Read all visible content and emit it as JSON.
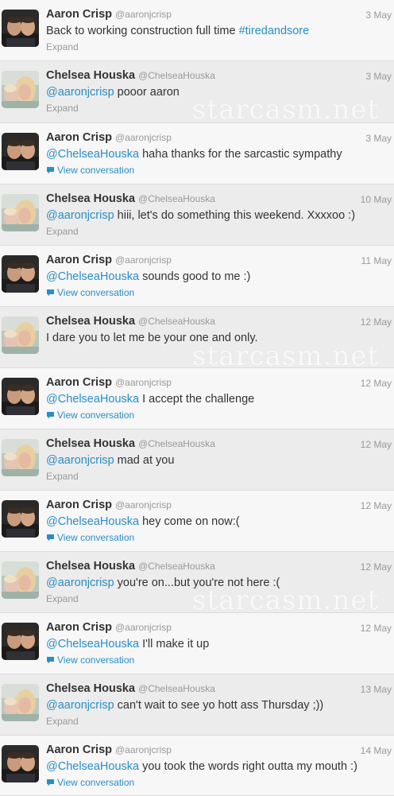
{
  "watermark": "starcasm.net",
  "tweets": [
    {
      "author": "Aaron Crisp",
      "handle": "@aaronjcrisp",
      "date": "3 May",
      "mention": "",
      "text": "Back to working construction full time ",
      "hashtag": "#tiredandsore",
      "action": "Expand",
      "avatar": "aaron"
    },
    {
      "author": "Chelsea Houska",
      "handle": "@ChelseaHouska",
      "date": "3 May",
      "mention": "@aaronjcrisp",
      "text": " pooor aaron",
      "hashtag": "",
      "action": "Expand",
      "avatar": "chelsea"
    },
    {
      "author": "Aaron Crisp",
      "handle": "@aaronjcrisp",
      "date": "3 May",
      "mention": "@ChelseaHouska",
      "text": " haha thanks for the sarcastic sympathy",
      "hashtag": "",
      "action": "View conversation",
      "avatar": "aaron"
    },
    {
      "author": "Chelsea Houska",
      "handle": "@ChelseaHouska",
      "date": "10 May",
      "mention": "@aaronjcrisp",
      "text": " hiii, let's do something this weekend. Xxxxoo :)",
      "hashtag": "",
      "action": "Expand",
      "avatar": "chelsea"
    },
    {
      "author": "Aaron Crisp",
      "handle": "@aaronjcrisp",
      "date": "11 May",
      "mention": "@ChelseaHouska",
      "text": " sounds good to me :)",
      "hashtag": "",
      "action": "View conversation",
      "avatar": "aaron"
    },
    {
      "author": "Chelsea Houska",
      "handle": "@ChelseaHouska",
      "date": "12 May",
      "mention": "",
      "text": "I dare you to let me be your one and only.",
      "hashtag": "",
      "action": "",
      "avatar": "chelsea"
    },
    {
      "author": "Aaron Crisp",
      "handle": "@aaronjcrisp",
      "date": "12 May",
      "mention": "@ChelseaHouska",
      "text": " I accept the challenge",
      "hashtag": "",
      "action": "View conversation",
      "avatar": "aaron"
    },
    {
      "author": "Chelsea Houska",
      "handle": "@ChelseaHouska",
      "date": "12 May",
      "mention": "@aaronjcrisp",
      "text": " mad at you",
      "hashtag": "",
      "action": "Expand",
      "avatar": "chelsea"
    },
    {
      "author": "Aaron Crisp",
      "handle": "@aaronjcrisp",
      "date": "12 May",
      "mention": "@ChelseaHouska",
      "text": " hey come on now:(",
      "hashtag": "",
      "action": "View conversation",
      "avatar": "aaron"
    },
    {
      "author": "Chelsea Houska",
      "handle": "@ChelseaHouska",
      "date": "12 May",
      "mention": "@aaronjcrisp",
      "text": " you're on...but you're not here :(",
      "hashtag": "",
      "action": "Expand",
      "avatar": "chelsea"
    },
    {
      "author": "Aaron Crisp",
      "handle": "@aaronjcrisp",
      "date": "12 May",
      "mention": "@ChelseaHouska",
      "text": " I'll make it up",
      "hashtag": "",
      "action": "View conversation",
      "avatar": "aaron"
    },
    {
      "author": "Chelsea Houska",
      "handle": "@ChelseaHouska",
      "date": "13 May",
      "mention": "@aaronjcrisp",
      "text": " can't wait to see yo hott ass Thursday ;))",
      "hashtag": "",
      "action": "Expand",
      "avatar": "chelsea"
    },
    {
      "author": "Aaron Crisp",
      "handle": "@aaronjcrisp",
      "date": "14 May",
      "mention": "@ChelseaHouska",
      "text": " you took the words right outta my mouth :)",
      "hashtag": "",
      "action": "View conversation",
      "avatar": "aaron"
    }
  ]
}
